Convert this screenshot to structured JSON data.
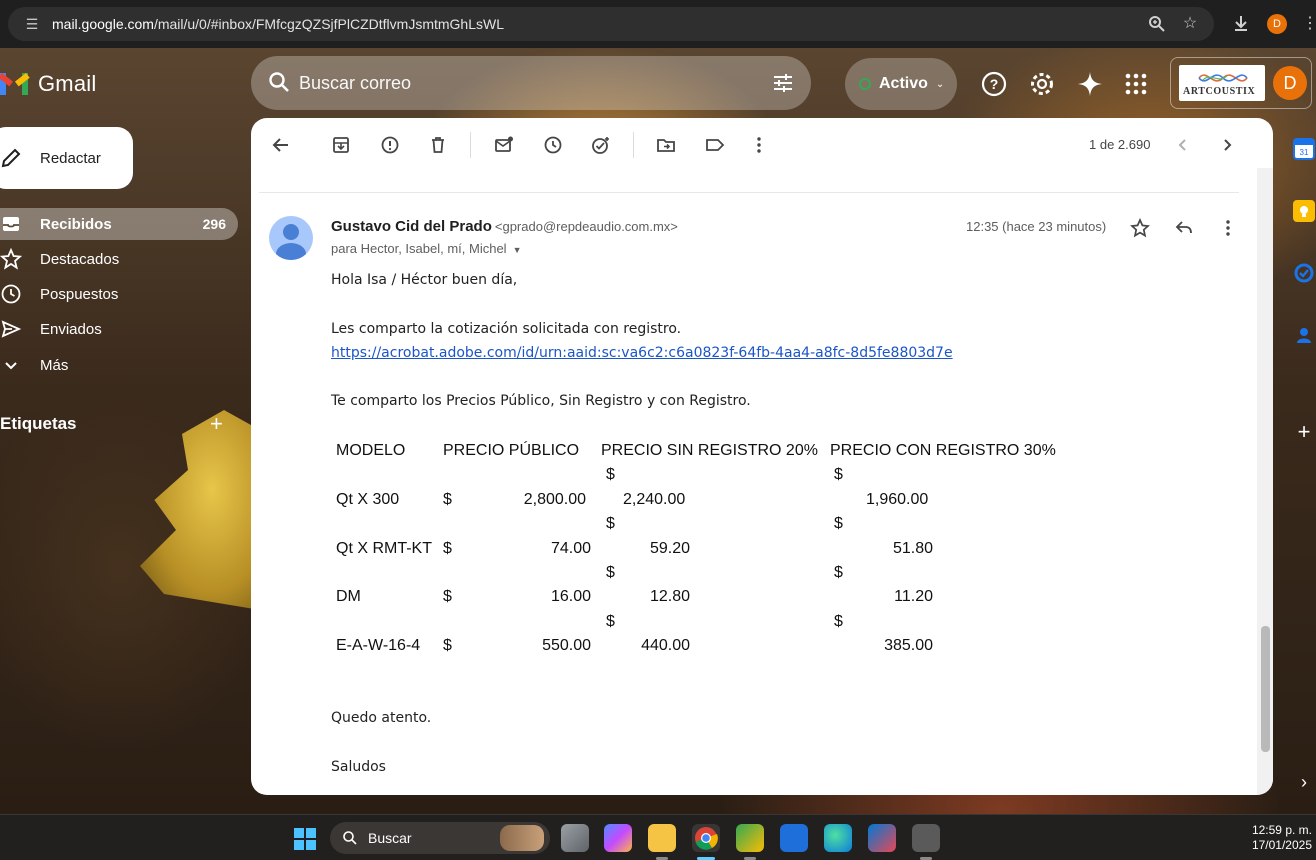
{
  "browser": {
    "url_prefix": "mail.google.com",
    "url_rest": "/mail/u/0/#inbox/FMfcgzQZSjfPlCZDtflvmJsmtmGhLsWL",
    "profile_initial": "D"
  },
  "header": {
    "app_name": "Gmail",
    "search_placeholder": "Buscar correo",
    "status_label": "Activo",
    "brand_name": "ARTCOUSTIX",
    "avatar_initial": "D"
  },
  "sidebar": {
    "compose_label": "Redactar",
    "items": [
      {
        "label": "Recibidos",
        "count": "296",
        "icon": "inbox-icon"
      },
      {
        "label": "Destacados",
        "count": "",
        "icon": "star-icon"
      },
      {
        "label": "Pospuestos",
        "count": "",
        "icon": "clock-icon"
      },
      {
        "label": "Enviados",
        "count": "",
        "icon": "send-icon"
      },
      {
        "label": "Más",
        "count": "",
        "icon": "chevron-down-icon"
      }
    ],
    "labels_title": "Etiquetas"
  },
  "toolbar": {
    "pager": "1 de 2.690"
  },
  "message": {
    "sender_name": "Gustavo Cid del Prado",
    "sender_email": "<gprado@repdeaudio.com.mx>",
    "recipients": "para Hector, Isabel, mí, Michel",
    "time": "12:35 (hace 23 minutos)",
    "greeting": "Hola Isa / Héctor buen día,",
    "line1": "Les comparto la cotización solicitada con registro.",
    "link": "https://acrobat.adobe.com/id/urn:aaid:sc:va6c2:c6a0823f-64fb-4aa4-a8fc-8d5fe8803d7e",
    "line2": "Te comparto los Precios Público, Sin Registro y con Registro.",
    "closing": "Quedo atento.",
    "signoff": "Saludos"
  },
  "price_table": {
    "headers": [
      "MODELO",
      "PRECIO PÚBLICO",
      "PRECIO SIN REGISTRO 20%",
      "PRECIO CON REGISTRO 30%"
    ],
    "currency_symbol": "$",
    "rows": [
      {
        "model": "Qt X 300",
        "public": "2,800.00",
        "sin": "2,240.00",
        "con": "1,960.00"
      },
      {
        "model": "Qt X RMT-KT",
        "public": "74.00",
        "sin": "59.20",
        "con": "51.80"
      },
      {
        "model": "DM",
        "public": "16.00",
        "sin": "12.80",
        "con": "11.20"
      },
      {
        "model": "E-A-W-16-4",
        "public": "550.00",
        "sin": "440.00",
        "con": "385.00"
      }
    ]
  },
  "taskbar": {
    "search_label": "Buscar",
    "time": "12:59 p. m.",
    "date": "17/01/2025"
  }
}
